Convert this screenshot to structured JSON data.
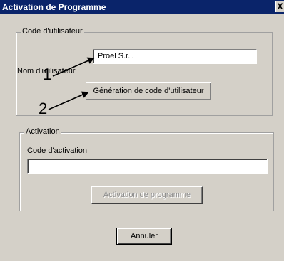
{
  "window": {
    "title": "Activation de Programme",
    "close_glyph": "X"
  },
  "user_group": {
    "legend": "Code d'utilisateur",
    "username_label": "Nom d'utilisateur",
    "username_value": "Proel S.r.l.",
    "generate_button": "Génération de code d'utilisateur"
  },
  "activation_group": {
    "legend": "Activation",
    "code_label": "Code d'activation",
    "code_value": "",
    "activate_button": "Activation de programme"
  },
  "cancel_button": "Annuler",
  "callouts": {
    "one": "1",
    "two": "2"
  },
  "colors": {
    "titlebar": "#0a246a",
    "face": "#d4d0c8"
  }
}
